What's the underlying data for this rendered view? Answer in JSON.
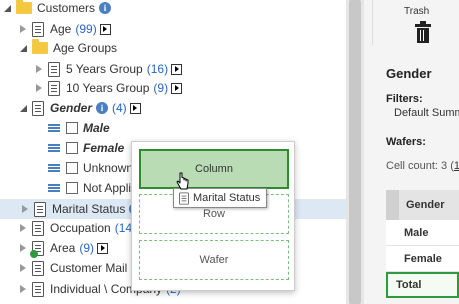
{
  "tree": {
    "customers": {
      "label": "Customers"
    },
    "age": {
      "label": "Age",
      "count": "(99)"
    },
    "age_groups": {
      "label": "Age Groups"
    },
    "five_years": {
      "label": "5 Years Group",
      "count": "(16)"
    },
    "ten_years": {
      "label": "10 Years Group",
      "count": "(9)"
    },
    "gender": {
      "label": "Gender",
      "count": "(4)"
    },
    "gender_values": [
      "Male",
      "Female",
      "Unknown",
      "Not Applic"
    ],
    "marital_status": {
      "label": "Marital Status"
    },
    "occupation": {
      "label": "Occupation",
      "count": "(14)"
    },
    "area": {
      "label": "Area",
      "count": "(9)"
    },
    "customer_mail": {
      "label": "Customer Mail In"
    },
    "individual_company": {
      "label": "Individual \\ Company",
      "count": "(2)"
    }
  },
  "drop_popup": {
    "column": "Column",
    "row": "Row",
    "wafer": "Wafer"
  },
  "drag_tooltip": "Marital Status",
  "right_panel": {
    "trash_label": "Trash",
    "title": "Gender",
    "filters_label": "Filters:",
    "filters_value": "Default Summ",
    "wafers_label": "Wafers:",
    "cell_count_label": "Cell count: 3 (",
    "cell_count_link": "1",
    "grid_header": "Gender",
    "grid_rows": [
      "Male",
      "Female"
    ],
    "grid_total": "Total"
  },
  "colors": {
    "accent_blue": "#4a7fc1",
    "count_blue": "#2a66c0",
    "drop_green": "#2e8b2e",
    "folder_yellow": "#f5c842"
  }
}
